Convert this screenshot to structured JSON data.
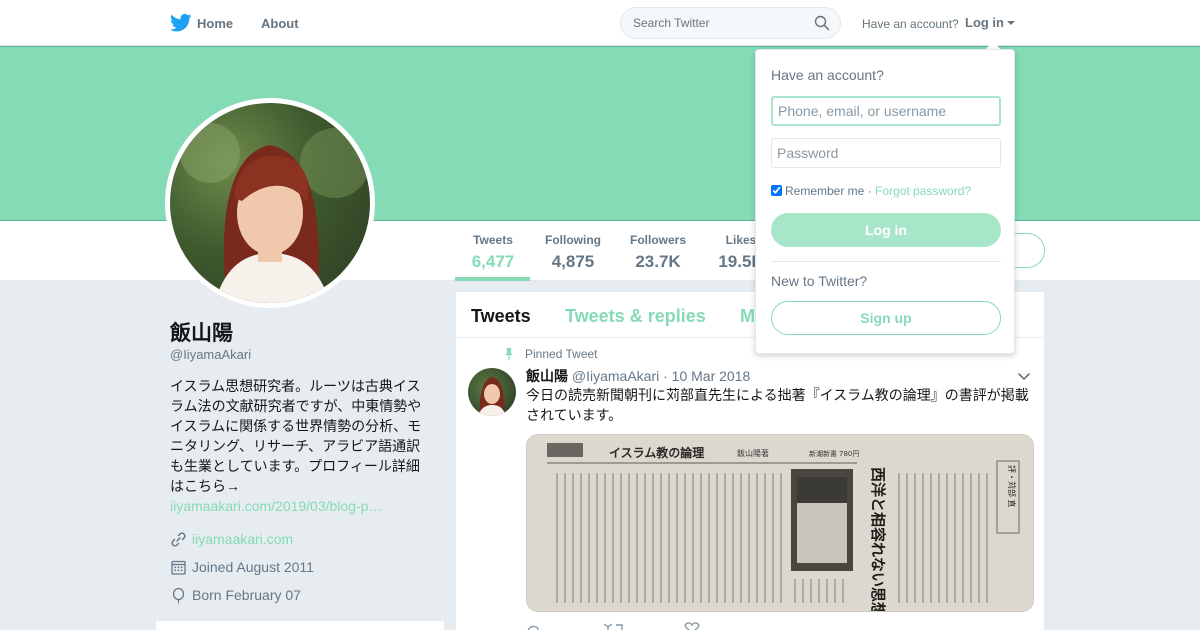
{
  "nav": {
    "home_label": "Home",
    "about_label": "About",
    "search_placeholder": "Search Twitter",
    "have_account_text": "Have an account?",
    "login_label": "Log in"
  },
  "colors": {
    "accent": "#84dbb6",
    "accent_light": "#a8e6ca",
    "background": "#e6ecf0"
  },
  "profile": {
    "name": "飯山陽",
    "handle": "@IiyamaAkari",
    "bio": "イスラム思想研究者。ルーツは古典イスラム法の文献研究者ですが、中東情勢やイスラムに関係する世界情勢の分析、モニタリング、リサーチ、アラビア語通訳も生業としています。プロフィール詳細はこちら→",
    "bio_link": "iiyamaakari.com/2019/03/blog-p…",
    "website": "iiyamaakari.com",
    "joined": "Joined August 2011",
    "born": "Born February 07"
  },
  "stats": [
    {
      "label": "Tweets",
      "value": "6,477"
    },
    {
      "label": "Following",
      "value": "4,875"
    },
    {
      "label": "Followers",
      "value": "23.7K"
    },
    {
      "label": "Likes",
      "value": "19.5K"
    }
  ],
  "timeline": {
    "tabs": [
      "Tweets",
      "Tweets & replies",
      "Media"
    ],
    "pinned_label": "Pinned Tweet",
    "tweet": {
      "name": "飯山陽",
      "handle": "@IiyamaAkari",
      "date": "· 10 Mar 2018",
      "text": "今日の読売新聞朝刊に苅部直先生による拙著『イスラム教の論理』の書評が掲載されています。",
      "image": {
        "heading": "イスラム教の論理",
        "author": "飯山陽著",
        "publisher": "新潮新書",
        "price": "780円",
        "headline": "西洋と相容れない思想",
        "reviewer": "評・苅部 直"
      }
    }
  },
  "login_dropdown": {
    "title": "Have an account?",
    "username_placeholder": "Phone, email, or username",
    "password_placeholder": "Password",
    "remember_label": "Remember me",
    "separator": " · ",
    "forgot_label": "Forgot password?",
    "login_button": "Log in",
    "new_label": "New to Twitter?",
    "signup_button": "Sign up"
  }
}
